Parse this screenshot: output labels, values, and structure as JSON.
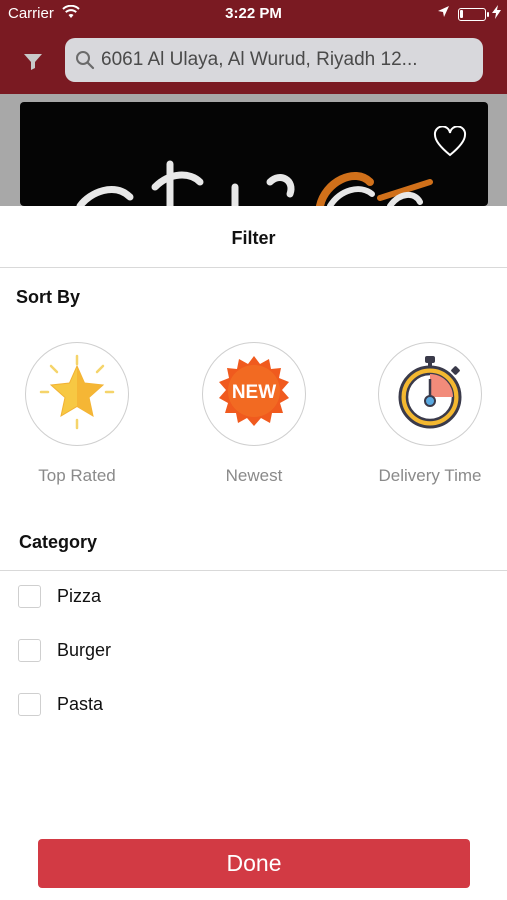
{
  "status_bar": {
    "carrier": "Carrier",
    "time": "3:22 PM",
    "battery_level": 0.15
  },
  "nav": {
    "search_value": "6061 Al Ulaya, Al Wurud, Riyadh 12...",
    "icons": {
      "filter": "filter-icon",
      "search": "search-icon"
    }
  },
  "background": {
    "icons": {
      "heart": "heart-icon"
    }
  },
  "filter_sheet": {
    "title": "Filter",
    "sort_by_title": "Sort By",
    "sort_options": [
      {
        "label": "Top Rated",
        "icon": "star-icon"
      },
      {
        "label": "Newest",
        "icon": "new-badge-icon",
        "badge_text": "NEW"
      },
      {
        "label": "Delivery Time",
        "icon": "stopwatch-icon"
      }
    ],
    "category_title": "Category",
    "categories": [
      {
        "label": "Pizza",
        "checked": false
      },
      {
        "label": "Burger",
        "checked": false
      },
      {
        "label": "Pasta",
        "checked": false
      }
    ],
    "done_label": "Done"
  },
  "colors": {
    "brand_dark_red": "#7a1a22",
    "done_button": "#d23a44",
    "search_bg": "#d8d8dc",
    "sort_label": "#8a8a8a"
  }
}
